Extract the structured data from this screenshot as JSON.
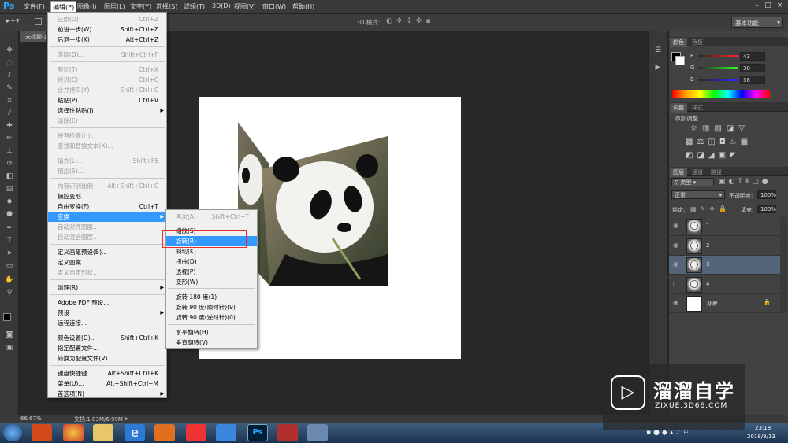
{
  "app": {
    "logo": "Ps",
    "title": "未标题-1 @ 66.7% (3, RGB/8)"
  },
  "menubar": {
    "items": [
      "文件(F)",
      "编辑(E)",
      "图像(I)",
      "图层(L)",
      "文字(Y)",
      "选择(S)",
      "滤镜(T)",
      "3D(D)",
      "视图(V)",
      "窗口(W)",
      "帮助(H)"
    ],
    "active_index": 1
  },
  "options_bar": {
    "mode_3d": "3D 模式:",
    "workspace": "基本功能"
  },
  "doc_tab": "未标题-1",
  "edit_menu": {
    "items": [
      {
        "label": "还原(O)",
        "shortcut": "Ctrl+Z",
        "disabled": true
      },
      {
        "label": "前进一步(W)",
        "shortcut": "Shift+Ctrl+Z",
        "disabled": false
      },
      {
        "label": "后退一步(K)",
        "shortcut": "Alt+Ctrl+Z",
        "disabled": false
      },
      {
        "label": "渐隐(D)...",
        "shortcut": "Shift+Ctrl+F",
        "disabled": true
      },
      {
        "label": "剪切(T)",
        "shortcut": "Ctrl+X",
        "disabled": true
      },
      {
        "label": "拷贝(C)",
        "shortcut": "Ctrl+C",
        "disabled": true
      },
      {
        "label": "合并拷贝(Y)",
        "shortcut": "Shift+Ctrl+C",
        "disabled": true
      },
      {
        "label": "粘贴(P)",
        "shortcut": "Ctrl+V",
        "disabled": false
      },
      {
        "label": "选择性粘贴(I)",
        "shortcut": "",
        "disabled": false,
        "submenu": true
      },
      {
        "label": "清除(E)",
        "shortcut": "",
        "disabled": true
      },
      {
        "label": "拼写检查(H)...",
        "shortcut": "",
        "disabled": true
      },
      {
        "label": "查找和替换文本(X)...",
        "shortcut": "",
        "disabled": true
      },
      {
        "label": "填充(L)...",
        "shortcut": "Shift+F5",
        "disabled": true
      },
      {
        "label": "描边(S)...",
        "shortcut": "",
        "disabled": true
      },
      {
        "label": "内容识别比例",
        "shortcut": "Alt+Shift+Ctrl+C",
        "disabled": true
      },
      {
        "label": "操控变形",
        "shortcut": "",
        "disabled": false
      },
      {
        "label": "自由变换(F)",
        "shortcut": "Ctrl+T",
        "disabled": false
      },
      {
        "label": "变换",
        "shortcut": "",
        "disabled": false,
        "submenu": true,
        "highlighted": true
      },
      {
        "label": "自动对齐图层...",
        "shortcut": "",
        "disabled": true
      },
      {
        "label": "自动混合图层...",
        "shortcut": "",
        "disabled": true
      },
      {
        "label": "定义画笔预设(B)...",
        "shortcut": "",
        "disabled": false
      },
      {
        "label": "定义图案...",
        "shortcut": "",
        "disabled": false
      },
      {
        "label": "定义自定形状...",
        "shortcut": "",
        "disabled": true
      },
      {
        "label": "清理(R)",
        "shortcut": "",
        "disabled": false,
        "submenu": true
      },
      {
        "label": "Adobe PDF 预设...",
        "shortcut": "",
        "disabled": false
      },
      {
        "label": "预设",
        "shortcut": "",
        "disabled": false,
        "submenu": true
      },
      {
        "label": "远程连接...",
        "shortcut": "",
        "disabled": false
      },
      {
        "label": "颜色设置(G)...",
        "shortcut": "Shift+Ctrl+K",
        "disabled": false
      },
      {
        "label": "指定配置文件...",
        "shortcut": "",
        "disabled": false
      },
      {
        "label": "转换为配置文件(V)...",
        "shortcut": "",
        "disabled": false
      },
      {
        "label": "键盘快捷键...",
        "shortcut": "Alt+Shift+Ctrl+K",
        "disabled": false
      },
      {
        "label": "菜单(U)...",
        "shortcut": "Alt+Shift+Ctrl+M",
        "disabled": false
      },
      {
        "label": "首选项(N)",
        "shortcut": "",
        "disabled": false,
        "submenu": true
      }
    ]
  },
  "transform_menu": {
    "items": [
      {
        "label": "再次(A)",
        "shortcut": "Shift+Ctrl+T",
        "disabled": true
      },
      {
        "label": "缩放(S)",
        "shortcut": "",
        "disabled": false
      },
      {
        "label": "旋转(R)",
        "shortcut": "",
        "disabled": false,
        "highlighted": true
      },
      {
        "label": "斜切(K)",
        "shortcut": "",
        "disabled": false
      },
      {
        "label": "扭曲(D)",
        "shortcut": "",
        "disabled": false
      },
      {
        "label": "透视(P)",
        "shortcut": "",
        "disabled": false
      },
      {
        "label": "变形(W)",
        "shortcut": "",
        "disabled": false
      },
      {
        "label": "旋转 180 度(1)",
        "shortcut": "",
        "disabled": false
      },
      {
        "label": "旋转 90 度(顺时针)(9)",
        "shortcut": "",
        "disabled": false
      },
      {
        "label": "旋转 90 度(逆时针)(0)",
        "shortcut": "",
        "disabled": false
      },
      {
        "label": "水平翻转(H)",
        "shortcut": "",
        "disabled": false
      },
      {
        "label": "垂直翻转(V)",
        "shortcut": "",
        "disabled": false
      }
    ]
  },
  "color_panel": {
    "tabs": [
      "颜色",
      "色板"
    ],
    "r_label": "R",
    "g_label": "G",
    "b_label": "B",
    "r": "43",
    "g": "38",
    "b": "38"
  },
  "adjust_panel": {
    "tabs": [
      "调整",
      "样式"
    ],
    "title": "添加调整"
  },
  "layers_panel": {
    "tabs": [
      "图层",
      "通道",
      "路径"
    ],
    "filter": "类型",
    "blend_mode": "正常",
    "opacity_label": "不透明度:",
    "opacity": "100%",
    "lock_label": "锁定:",
    "fill_label": "填充:",
    "fill": "100%",
    "layers": [
      {
        "name": "1",
        "selected": false,
        "visible": true
      },
      {
        "name": "2",
        "selected": false,
        "visible": true
      },
      {
        "name": "3",
        "selected": true,
        "visible": true
      },
      {
        "name": "4",
        "selected": false,
        "visible": false
      },
      {
        "name": "背景",
        "selected": false,
        "visible": true,
        "locked": true
      }
    ]
  },
  "status": {
    "zoom": "66.67%",
    "doc": "文档:1.83M/6.99M"
  },
  "taskbar": {
    "time": "23:18",
    "date": "2018/8/13"
  },
  "watermark": {
    "title": "溜溜自学",
    "url": "ZIXUE.3D66.COM"
  }
}
